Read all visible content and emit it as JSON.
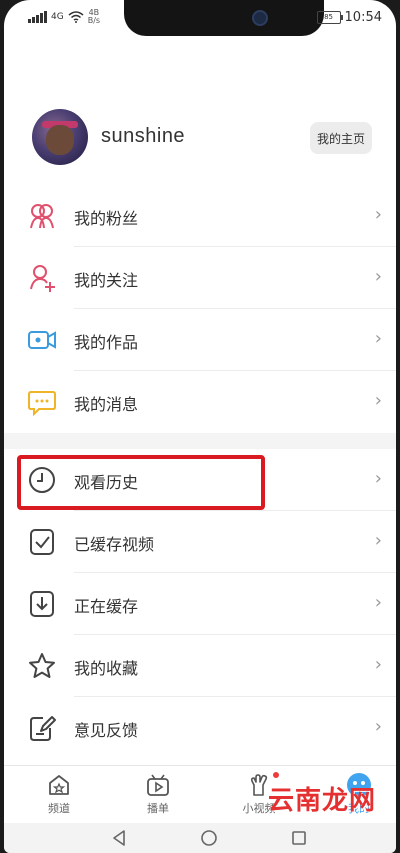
{
  "status": {
    "network": "4G",
    "speed_top": "4B",
    "speed_bottom": "B/s",
    "battery": "85",
    "time": "10:54"
  },
  "profile": {
    "username": "sunshine",
    "homepage_label": "我的主页"
  },
  "menu": [
    {
      "label": "我的粉丝",
      "icon": "fans-icon"
    },
    {
      "label": "我的关注",
      "icon": "follow-icon"
    },
    {
      "label": "我的作品",
      "icon": "video-camera-icon"
    },
    {
      "label": "我的消息",
      "icon": "message-icon"
    },
    {
      "label": "观看历史",
      "icon": "clock-icon"
    },
    {
      "label": "已缓存视频",
      "icon": "cached-check-icon"
    },
    {
      "label": "正在缓存",
      "icon": "download-icon"
    },
    {
      "label": "我的收藏",
      "icon": "star-icon"
    },
    {
      "label": "意见反馈",
      "icon": "feedback-icon"
    }
  ],
  "chevron": "›",
  "tabs": [
    {
      "label": "频道",
      "icon": "home-icon"
    },
    {
      "label": "播单",
      "icon": "playlist-icon"
    },
    {
      "label": "小视频",
      "icon": "short-video-icon"
    },
    {
      "label": "我的",
      "icon": "me-icon"
    }
  ],
  "watermark": "云南龙网",
  "colors": {
    "accent": "#3fa3ee",
    "highlight": "#d91a20",
    "fans": "#e0516e",
    "video": "#3b9be0",
    "message": "#f0b429",
    "watermark": "#e43030"
  }
}
